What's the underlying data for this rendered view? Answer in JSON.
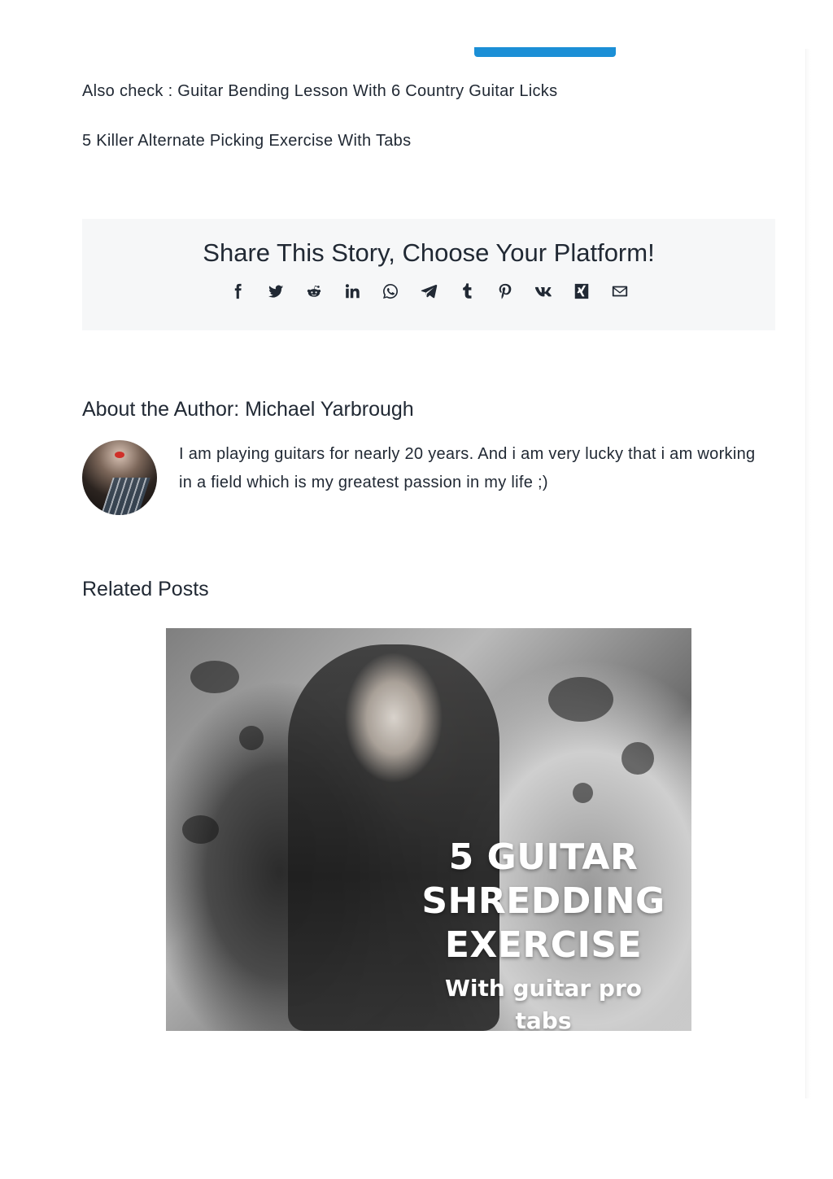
{
  "colors": {
    "accent": "#1b8fd6",
    "text": "#212934",
    "share_box_bg": "#f6f7f8"
  },
  "links": {
    "also_check": "Also check : Guitar Bending Lesson With 6 Country Guitar Licks",
    "killer_picking": "5 Killer Alternate Picking Exercise With Tabs"
  },
  "share": {
    "title": "Share This Story, Choose Your Platform!",
    "icons": [
      "facebook-icon",
      "twitter-icon",
      "reddit-icon",
      "linkedin-icon",
      "whatsapp-icon",
      "telegram-icon",
      "tumblr-icon",
      "pinterest-icon",
      "vk-icon",
      "xing-icon",
      "email-icon"
    ]
  },
  "author": {
    "heading": "About the Author: Michael Yarbrough",
    "bio": "I am playing guitars for nearly 20 years. And i am very lucky that i am working in a field which is my greatest passion in my life ;)"
  },
  "related": {
    "heading": "Related Posts",
    "post_image_caption": {
      "line1": "5 GUITAR",
      "line2": "SHREDDING",
      "line3": "EXERCISE",
      "sub": "With guitar pro tabs"
    }
  }
}
